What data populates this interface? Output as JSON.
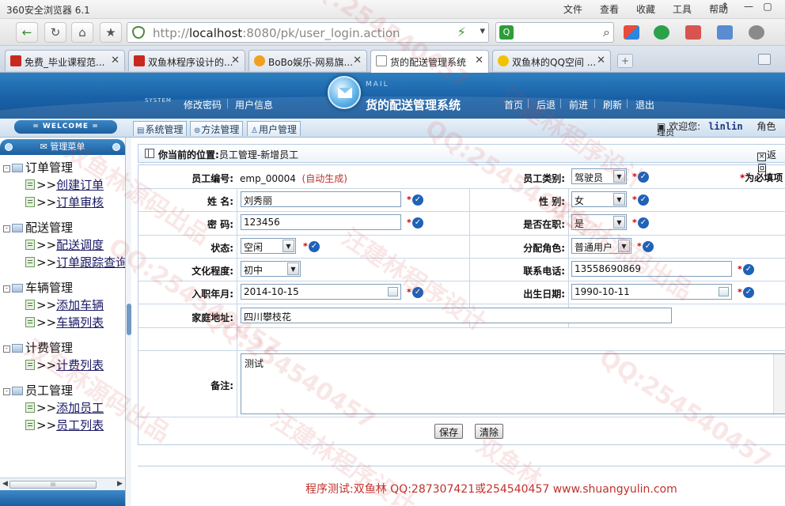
{
  "browser": {
    "title": "360安全浏览器 6.1",
    "menu": [
      "文件",
      "查看",
      "收藏",
      "工具",
      "帮助"
    ],
    "url_prefix": "http://",
    "url_host": "localhost",
    "url_rest": ":8080/pk/user_login.action",
    "tabs": [
      {
        "label": "免费_毕业课程范...",
        "fav_color": "#c8281f"
      },
      {
        "label": "双鱼林程序设计的...",
        "fav_color": "#c8281f"
      },
      {
        "label": "BoBo娱乐-网易旗...",
        "fav_color": "#f0a020"
      },
      {
        "label": "货的配送管理系统",
        "fav_color": "#ffffff"
      },
      {
        "label": "双鱼林的QQ空间 ...",
        "fav_color": "#f2c200"
      }
    ]
  },
  "app": {
    "system_tag": "SYSTEM",
    "header_links_left": [
      "修改密码",
      "用户信息"
    ],
    "logo_caption": "MAIL",
    "system_name": "货的配送管理系统",
    "header_links_right": [
      "首页",
      "后退",
      "前进",
      "刷新",
      "退出"
    ],
    "welcome_badge": "= WELCOME =",
    "subtabs": [
      "系统管理",
      "方法管理",
      "用户管理"
    ],
    "welcome_text": "欢迎您:",
    "username": "linlin",
    "role_text": "角色",
    "role_text2": "理员"
  },
  "sidebar": {
    "title": "管理菜单",
    "groups": [
      {
        "label": "订单管理",
        "items": [
          "创建订单",
          "订单审核"
        ]
      },
      {
        "label": "配送管理",
        "items": [
          "配送调度",
          "订单跟踪查询"
        ]
      },
      {
        "label": "车辆管理",
        "items": [
          "添加车辆",
          "车辆列表"
        ]
      },
      {
        "label": "计费管理",
        "items": [
          "计费列表"
        ]
      },
      {
        "label": "员工管理",
        "items": [
          "添加员工",
          "员工列表"
        ]
      }
    ],
    "item_prefix": ">>",
    "scroll_thumb": "III"
  },
  "main": {
    "crumb_label": "你当前的位置:",
    "crumb_path": "员工管理-新增员工",
    "back": "返回",
    "required_note": "为必填项",
    "form": {
      "emp_no_label": "员工编号:",
      "emp_no_value": "emp_00004",
      "emp_no_hint": "(自动生成)",
      "emp_type_label": "员工类别:",
      "emp_type_value": "驾驶员",
      "name_label": "姓    名:",
      "name_value": "刘秀丽",
      "gender_label": "性    别:",
      "gender_value": "女",
      "password_label": "密    码:",
      "password_value": "123456",
      "onjob_label": "是否在职:",
      "onjob_value": "是",
      "status_label": "状态:",
      "status_value": "空闲",
      "role_label": "分配角色:",
      "role_value": "普通用户",
      "edu_label": "文化程度:",
      "edu_value": "初中",
      "phone_label": "联系电话:",
      "phone_value": "13558690869",
      "hire_label": "入职年月:",
      "hire_value": "2014-10-15",
      "birth_label": "出生日期:",
      "birth_value": "1990-10-11",
      "address_label": "家庭地址:",
      "address_value": "四川攀枝花",
      "remark_label": "备注:",
      "remark_value": "测试",
      "required_mark": "*"
    },
    "save_button": "保存",
    "clear_button": "清除",
    "footer": "程序测试:双鱼林 QQ:287307421或254540457 www.shuangyulin.com"
  },
  "watermarks": [
    "QQ:254540457",
    "汪建林程序设计",
    "双鱼林源码出品",
    "QQ:254540457",
    "汪建林程序设计",
    "双鱼林源码出品",
    "QQ:254540457",
    "双鱼林源码出品",
    "QQ:254540457",
    "汪建林程序设计",
    "QQ:254540457",
    "双鱼林"
  ]
}
